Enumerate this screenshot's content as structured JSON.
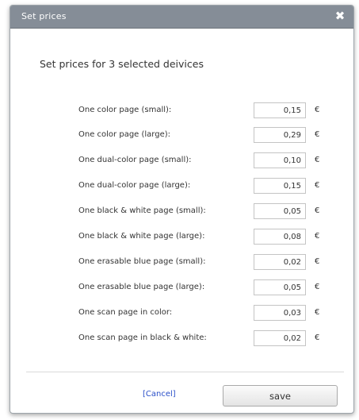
{
  "dialog": {
    "title": "Set prices",
    "close_symbol": "✖",
    "heading": "Set prices for 3 selected deivices"
  },
  "prices": [
    {
      "label": "One color page (small):",
      "value": "0,15",
      "currency": "€"
    },
    {
      "label": "One color page (large):",
      "value": "0,29",
      "currency": "€"
    },
    {
      "label": "One dual-color page (small):",
      "value": "0,10",
      "currency": "€"
    },
    {
      "label": "One dual-color page (large):",
      "value": "0,15",
      "currency": "€"
    },
    {
      "label": "One black & white page (small):",
      "value": "0,05",
      "currency": "€"
    },
    {
      "label": "One black & white page (large):",
      "value": "0,08",
      "currency": "€"
    },
    {
      "label": "One erasable blue page (small):",
      "value": "0,02",
      "currency": "€"
    },
    {
      "label": "One erasable blue page (large):",
      "value": "0,05",
      "currency": "€"
    },
    {
      "label": "One scan page in color:",
      "value": "0,03",
      "currency": "€"
    },
    {
      "label": "One scan page in black & white:",
      "value": "0,02",
      "currency": "€"
    }
  ],
  "footer": {
    "cancel_label": "[Cancel]",
    "save_label": "save"
  },
  "colors": {
    "titlebar": "#858d97",
    "link": "#2a4fc9"
  }
}
